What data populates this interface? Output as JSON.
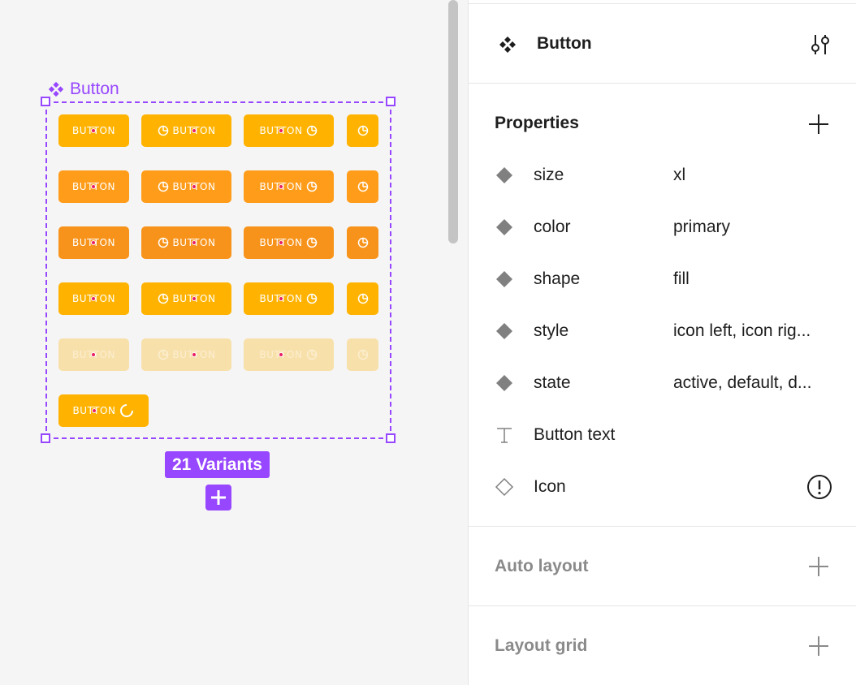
{
  "canvas": {
    "component_set_label": "Button",
    "variants_badge": "21 Variants",
    "button_rows": [
      {
        "state": "default"
      },
      {
        "state": "hover"
      },
      {
        "state": "active"
      },
      {
        "state": "focus"
      },
      {
        "state": "disabled"
      }
    ],
    "button_text": "BUTTON",
    "colors": {
      "accent": "#9747ff",
      "primary": "#ffb300"
    }
  },
  "panel": {
    "component_name": "Button",
    "properties_title": "Properties",
    "properties": [
      {
        "icon": "variant-diamond-icon",
        "name": "size",
        "value": "xl"
      },
      {
        "icon": "variant-diamond-icon",
        "name": "color",
        "value": "primary"
      },
      {
        "icon": "variant-diamond-icon",
        "name": "shape",
        "value": "fill"
      },
      {
        "icon": "variant-diamond-icon",
        "name": "style",
        "value": "icon left, icon rig..."
      },
      {
        "icon": "variant-diamond-icon",
        "name": "state",
        "value": "active, default, d..."
      },
      {
        "icon": "text-property-icon",
        "name": "Button text",
        "value": ""
      },
      {
        "icon": "instance-swap-icon",
        "name": "Icon",
        "value": ""
      }
    ],
    "auto_layout_title": "Auto layout",
    "layout_grid_title": "Layout grid"
  }
}
